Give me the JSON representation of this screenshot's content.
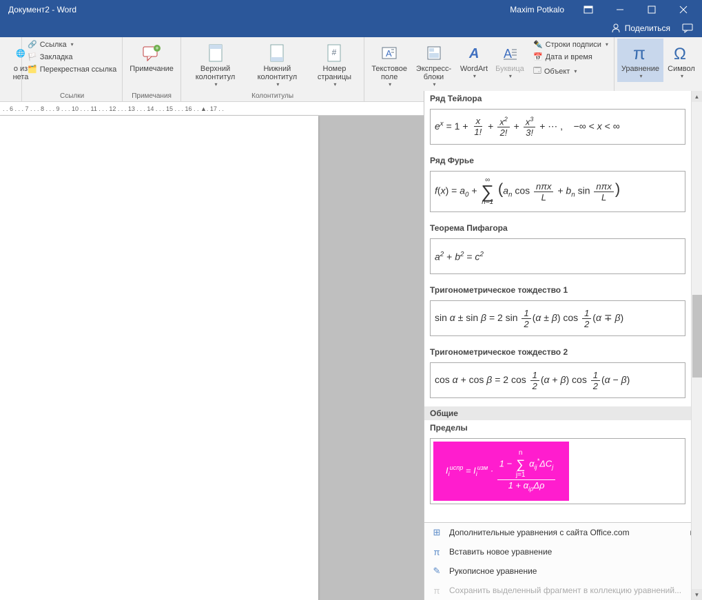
{
  "title": "Документ2  -  Word",
  "user": "Maxim Potkalo",
  "share": "Поделиться",
  "ribbon": {
    "links": {
      "hyperlink": "Ссылка",
      "bookmark": "Закладка",
      "crossref": "Перекрестная ссылка",
      "group": "Ссылки"
    },
    "comments": {
      "comment": "Примечание",
      "group": "Примечания"
    },
    "headerfooter": {
      "header": "Верхний колонтитул",
      "footer": "Нижний колонтитул",
      "pageno": "Номер страницы",
      "group": "Колонтитулы"
    },
    "text": {
      "textbox": "Текстовое поле",
      "quick": "Экспресс-блоки",
      "wordart": "WordArt",
      "dropcap": "Буквица",
      "sigline": "Строки подписи",
      "datetime": "Дата и время",
      "object": "Объект"
    },
    "symbols": {
      "equation": "Уравнение",
      "symbol": "Символ"
    },
    "internet_group": "о из нета"
  },
  "ruler": ". . 6 . . . 7 . . . 8 . . . 9 . . . 10 . . . 11 . . . 12 . . . 13 . . . 14 . . . 15 . . . 16 . . ▲. 17 . .",
  "eq_gallery": {
    "taylor_head": "Ряд Тейлора",
    "fourier_head": "Ряд Фурье",
    "pyth_head": "Теорема Пифагора",
    "trig1_head": "Тригонометрическое тождество 1",
    "trig2_head": "Тригонометрическое тождество 2",
    "general_cat": "Общие",
    "limits_head": "Пределы"
  },
  "eq_menu": {
    "office": "Дополнительные уравнения с сайта Office.com",
    "insert": "Вставить новое уравнение",
    "ink": "Рукописное уравнение",
    "save": "Сохранить выделенный фрагмент в коллекцию уравнений..."
  }
}
